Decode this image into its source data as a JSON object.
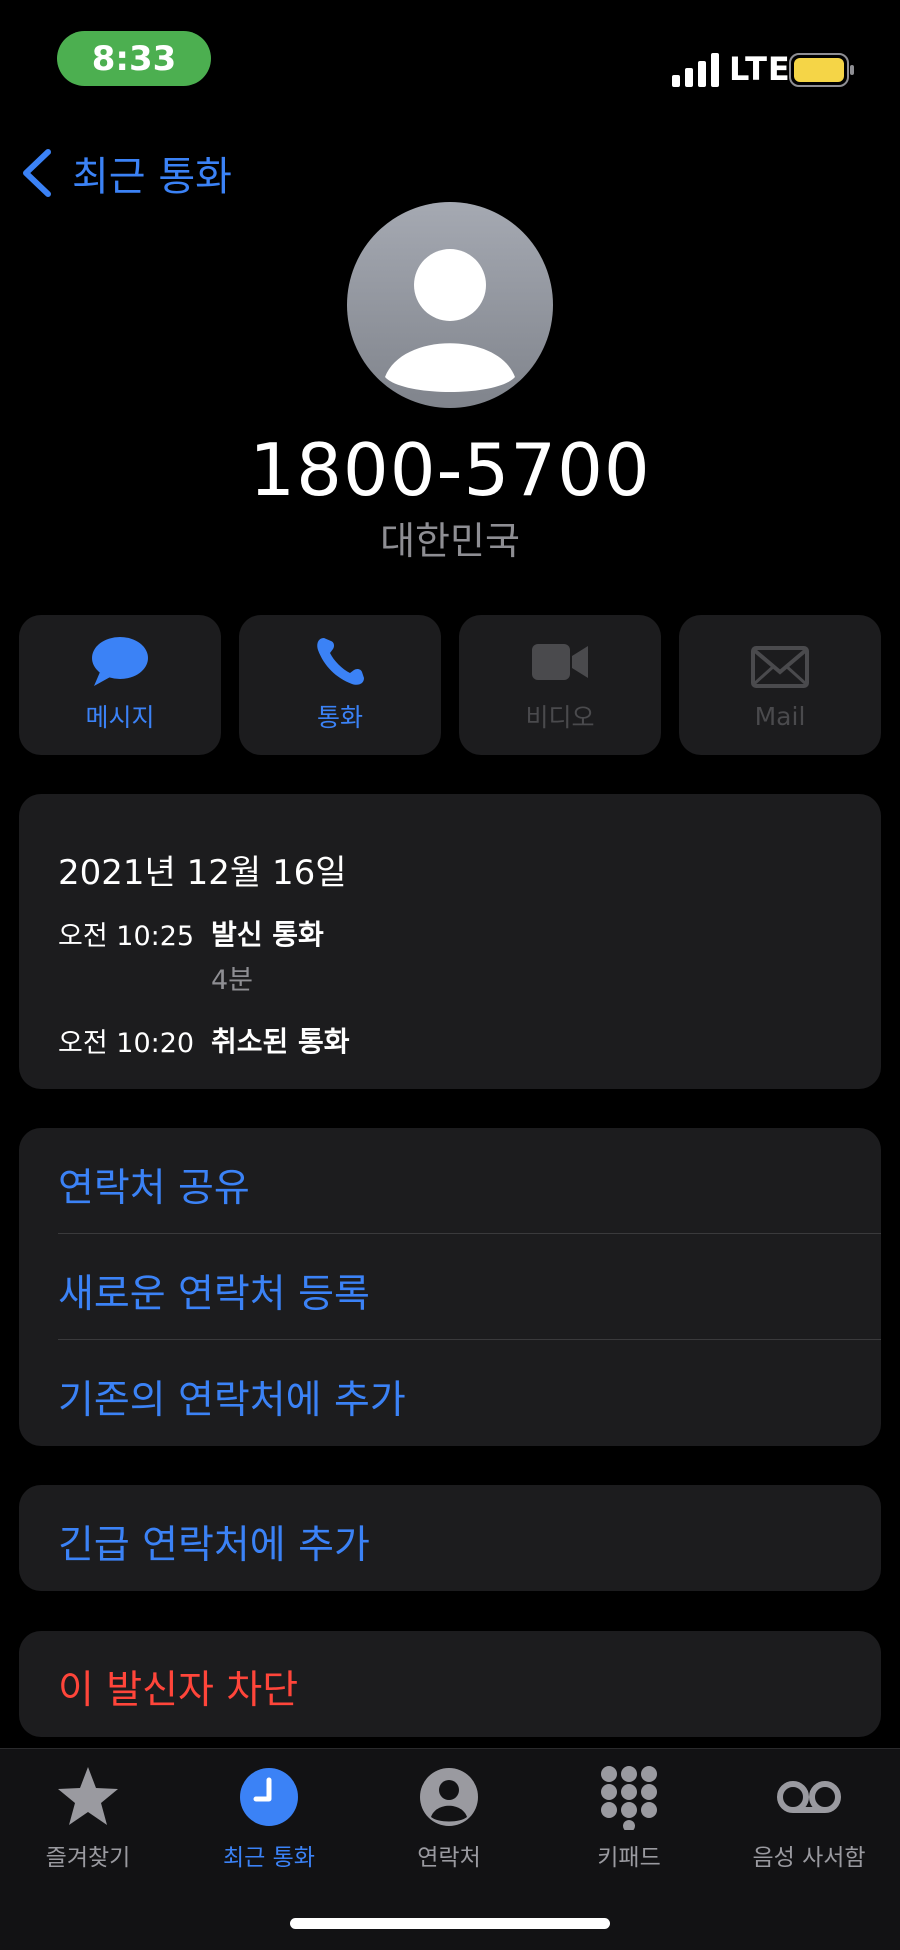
{
  "status_bar": {
    "time": "8:33",
    "network": "LTE",
    "colors": {
      "time_pill": "#4caf50",
      "battery": "#f5d547"
    }
  },
  "nav": {
    "back_label": "최근 통화"
  },
  "contact": {
    "number": "1800-5700",
    "region": "대한민국"
  },
  "actions": [
    {
      "label": "메시지",
      "icon": "message-bubble-icon",
      "enabled": true
    },
    {
      "label": "통화",
      "icon": "phone-icon",
      "enabled": true
    },
    {
      "label": "비디오",
      "icon": "video-camera-icon",
      "enabled": false
    },
    {
      "label": "Mail",
      "icon": "envelope-icon",
      "enabled": false
    }
  ],
  "call_history": {
    "date": "2021년 12월 16일",
    "entries": [
      {
        "time": "오전 10:25",
        "type": "발신 통화",
        "duration": "4분"
      },
      {
        "time": "오전 10:20",
        "type": "취소된 통화"
      }
    ]
  },
  "contact_actions": {
    "share": "연락처 공유",
    "create_new": "새로운 연락처 등록",
    "add_existing": "기존의 연락처에 추가"
  },
  "emergency": {
    "label": "긴급 연락처에 추가"
  },
  "block": {
    "label": "이 발신자 차단"
  },
  "tabs": [
    {
      "label": "즐겨찾기",
      "icon": "star-icon",
      "active": false
    },
    {
      "label": "최근 통화",
      "icon": "clock-icon",
      "active": true
    },
    {
      "label": "연락처",
      "icon": "person-circle-icon",
      "active": false
    },
    {
      "label": "키패드",
      "icon": "keypad-icon",
      "active": false
    },
    {
      "label": "음성 사서함",
      "icon": "voicemail-icon",
      "active": false
    }
  ],
  "colors": {
    "accent": "#3b82f6",
    "danger": "#ff453a",
    "card": "#1c1c1e"
  }
}
